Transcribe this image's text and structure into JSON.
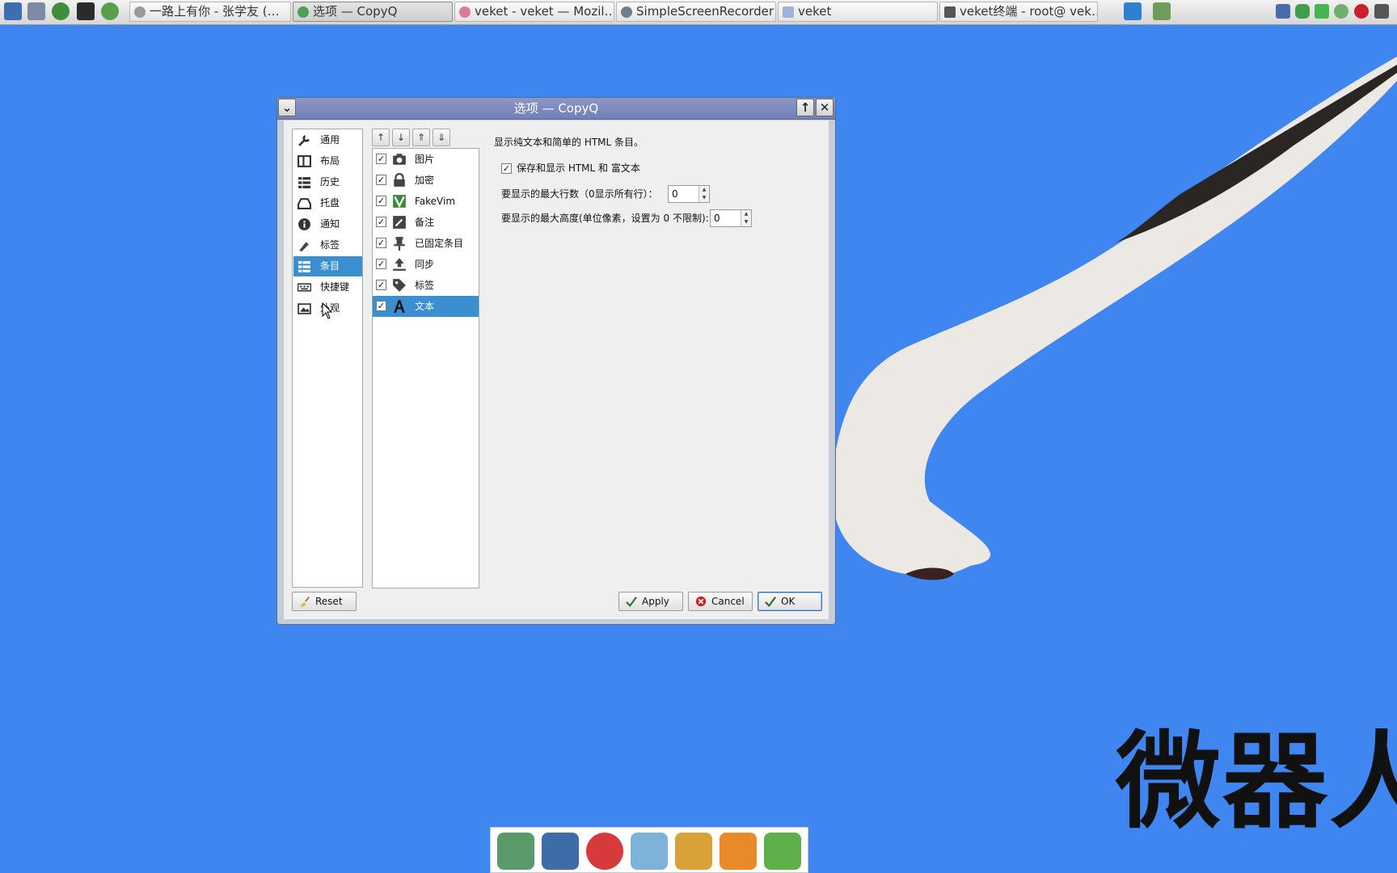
{
  "taskbar": {
    "launchers": [
      "system-monitor-icon",
      "settings-icon",
      "media-player-icon",
      "terminal-icon",
      "browser-icon"
    ],
    "tasks": [
      {
        "label": "一路上有你 - 张学友 (…",
        "icon": "music-icon"
      },
      {
        "label": "选项 — CopyQ",
        "icon": "copyq-icon",
        "active": true
      },
      {
        "label": "veket - veket — Mozil…",
        "icon": "firefox-icon"
      },
      {
        "label": "SimpleScreenRecorder",
        "icon": "recorder-icon"
      },
      {
        "label": "veket",
        "icon": "folder-icon"
      },
      {
        "label": "veket终端 - root@ vek…",
        "icon": "terminal-icon"
      }
    ],
    "tray": [
      "network-icon",
      "shield-icon",
      "database-icon",
      "copyq-tray-icon",
      "record-icon",
      "keyboard-icon"
    ]
  },
  "desktop": {
    "watermark": "微器人",
    "dock": [
      "file-manager-icon",
      "computer-icon",
      "mascot-icon",
      "editor-icon",
      "paint-icon",
      "veket-app-icon",
      "help-icon"
    ]
  },
  "dialog": {
    "title": "选项 — CopyQ",
    "categories": [
      {
        "label": "通用",
        "icon": "wrench-icon"
      },
      {
        "label": "布局",
        "icon": "layout-icon"
      },
      {
        "label": "历史",
        "icon": "list-icon"
      },
      {
        "label": "托盘",
        "icon": "tray-icon"
      },
      {
        "label": "通知",
        "icon": "info-icon"
      },
      {
        "label": "标签",
        "icon": "tag-pen-icon"
      },
      {
        "label": "条目",
        "icon": "items-icon",
        "selected": true
      },
      {
        "label": "快捷键",
        "icon": "keyboard-icon"
      },
      {
        "label": "外观",
        "icon": "image-icon"
      }
    ],
    "plugin_toolbar": [
      "move-up-icon",
      "move-down-icon",
      "move-top-icon",
      "move-bottom-icon"
    ],
    "plugins": [
      {
        "label": "图片",
        "icon": "camera-icon",
        "checked": true
      },
      {
        "label": "加密",
        "icon": "lock-icon",
        "checked": true
      },
      {
        "label": "FakeVim",
        "icon": "vim-icon",
        "checked": true
      },
      {
        "label": "备注",
        "icon": "pencil-icon",
        "checked": true
      },
      {
        "label": "已固定条目",
        "icon": "pin-icon",
        "checked": true
      },
      {
        "label": "同步",
        "icon": "upload-icon",
        "checked": true
      },
      {
        "label": "标签",
        "icon": "tag-icon",
        "checked": true
      },
      {
        "label": "文本",
        "icon": "text-icon",
        "checked": true,
        "selected": true
      }
    ],
    "settings": {
      "description": "显示纯文本和简单的 HTML 条目。",
      "save_html_label": "保存和显示 HTML 和 富文本",
      "save_html_checked": true,
      "max_lines_label": "要显示的最大行数（0显示所有行）：",
      "max_lines_value": "0",
      "max_height_label": "要显示的最大高度(单位像素，设置为 0 不限制):",
      "max_height_value": "0"
    },
    "buttons": {
      "reset": "Reset",
      "apply": "Apply",
      "cancel": "Cancel",
      "ok": "OK"
    }
  }
}
